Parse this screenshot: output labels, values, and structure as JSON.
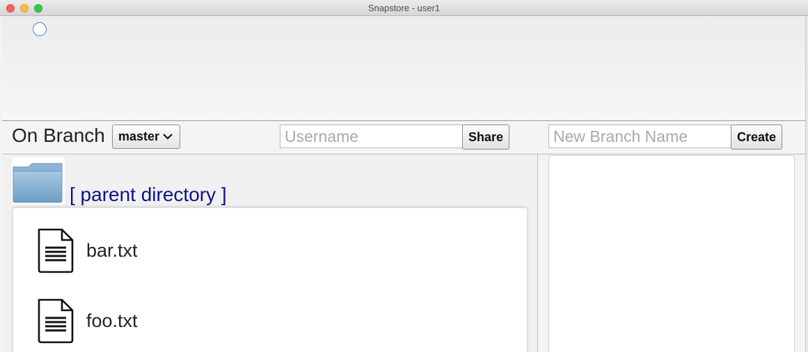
{
  "window": {
    "title": "Snapstore - user1"
  },
  "toolbar": {
    "branch_label": "On Branch",
    "branch_selected": "master",
    "username_placeholder": "Username",
    "share_label": "Share",
    "new_branch_placeholder": "New Branch Name",
    "create_label": "Create"
  },
  "browser": {
    "parent_link": "[ parent directory ]",
    "files": [
      {
        "name": "bar.txt",
        "icon": "text-file-icon"
      },
      {
        "name": "foo.txt",
        "icon": "text-file-icon"
      }
    ]
  },
  "colors": {
    "link": "#11118a",
    "spinner": "#4a86c8"
  }
}
